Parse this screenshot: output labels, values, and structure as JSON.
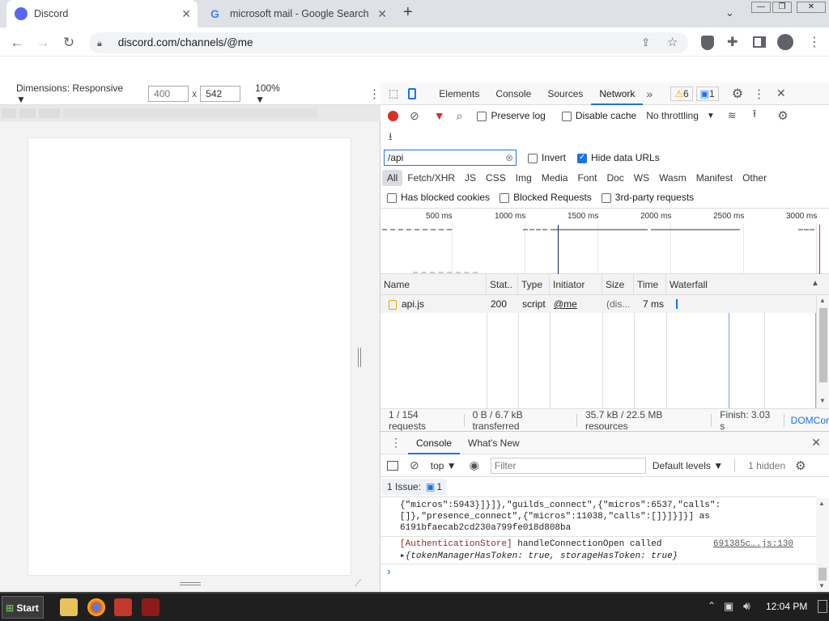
{
  "browser": {
    "tabs": [
      {
        "title": "Discord",
        "favicon": "discord-icon",
        "active": true
      },
      {
        "title": "microsoft mail - Google Search",
        "favicon": "google-icon",
        "active": false
      }
    ],
    "new_tab_label": "+",
    "url": "discord.com/channels/@me"
  },
  "emulation": {
    "dimensions_label": "Dimensions: Responsive ▼",
    "width_placeholder": "400",
    "height_value": "542",
    "times": "x",
    "zoom": "100% ▼"
  },
  "devtools": {
    "tabs": [
      "Elements",
      "Console",
      "Sources",
      "Network"
    ],
    "more_tabs": "»",
    "selected_tab": "Network",
    "warnings_count": "6",
    "messages_count": "1",
    "toolbar": {
      "preserve_log": "Preserve log",
      "disable_cache": "Disable cache",
      "throttling": "No throttling"
    },
    "filter": {
      "value": "/api",
      "invert": "Invert",
      "hide_data_urls": "Hide data URLs",
      "types": [
        "All",
        "Fetch/XHR",
        "JS",
        "CSS",
        "Img",
        "Media",
        "Font",
        "Doc",
        "WS",
        "Wasm",
        "Manifest",
        "Other"
      ],
      "has_blocked_cookies": "Has blocked cookies",
      "blocked_requests": "Blocked Requests",
      "third_party": "3rd-party requests"
    },
    "timeline_ticks": [
      "500 ms",
      "1000 ms",
      "1500 ms",
      "2000 ms",
      "2500 ms",
      "3000 ms"
    ],
    "table": {
      "columns": [
        "Name",
        "Stat..",
        "Type",
        "Initiator",
        "Size",
        "Time",
        "Waterfall"
      ],
      "rows": [
        {
          "name": "api.js",
          "status": "200",
          "type": "script",
          "initiator": "@me",
          "size": "(dis...",
          "time": "7 ms"
        }
      ]
    },
    "status": {
      "requests": "1 / 154 requests",
      "transferred": "0 B / 6.7 kB transferred",
      "resources": "35.7 kB / 22.5 MB resources",
      "finish": "Finish: 3.03 s",
      "domcontent": "DOMCor"
    },
    "drawer": {
      "tabs": [
        "Console",
        "What's New"
      ],
      "context": "top",
      "filter_placeholder": "Filter",
      "levels": "Default levels ▼",
      "hidden": "1 hidden",
      "issues_label": "1 Issue:",
      "issues_count": "1",
      "log_line1": "{\"micros\":5943}]}]},\"guilds_connect\",{\"micros\":6537,\"calls\":",
      "log_line2": "[]},\"presence_connect\",{\"micros\":11038,\"calls\":[]}]}]}] as",
      "log_line3": "6191bfaecab2cd230a799fe018d808ba",
      "log_store": "[AuthenticationStore]",
      "log_msg": " handleConnectionOpen called",
      "log_source": "691385c….js:130",
      "log_obj": "▸{tokenManagerHasToken: true, storageHasToken: true}",
      "prompt": "›"
    }
  },
  "taskbar": {
    "start": "Start",
    "clock": "12:04 PM"
  }
}
